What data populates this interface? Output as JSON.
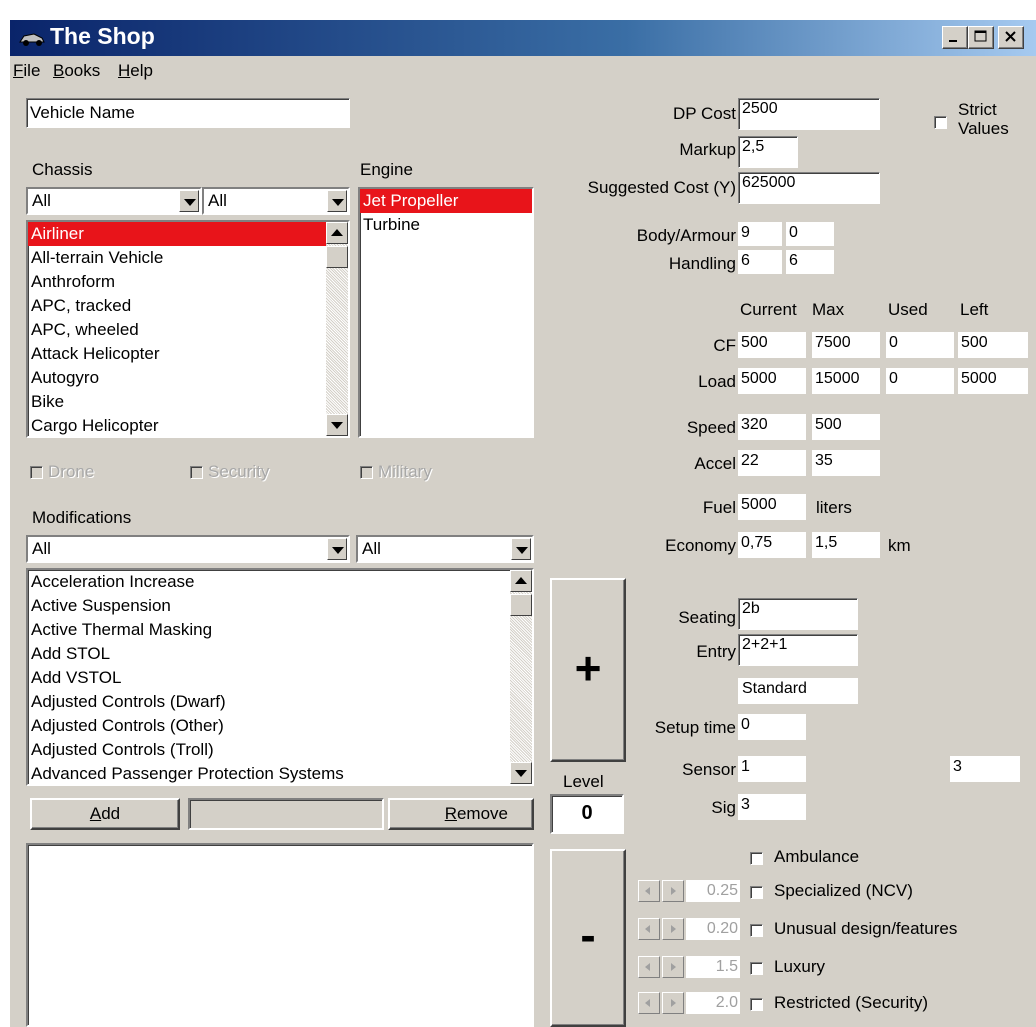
{
  "window": {
    "title": "The Shop"
  },
  "menu": [
    {
      "key": "F",
      "rest": "ile"
    },
    {
      "key": "B",
      "rest": "ooks"
    },
    {
      "key": "H",
      "rest": "elp"
    }
  ],
  "vehicle_name": "Vehicle Name",
  "chassis": {
    "label": "Chassis",
    "filter1": "All",
    "filter2": "All",
    "items": [
      "Airliner",
      "All-terrain Vehicle",
      "Anthroform",
      "APC, tracked",
      "APC, wheeled",
      "Attack Helicopter",
      "Autogyro",
      "Bike",
      "Cargo Helicopter"
    ],
    "selected_index": 0
  },
  "engine": {
    "label": "Engine",
    "items": [
      "Jet Propeller",
      "Turbine"
    ],
    "selected_index": 0
  },
  "flags": {
    "drone": "Drone",
    "security": "Security",
    "military": "Military"
  },
  "modifications": {
    "label": "Modifications",
    "filter1": "All",
    "filter2": "All",
    "items": [
      "Acceleration Increase",
      "Active Suspension",
      "Active Thermal Masking",
      "Add STOL",
      "Add VSTOL",
      "Adjusted Controls (Dwarf)",
      "Adjusted Controls (Other)",
      "Adjusted Controls (Troll)",
      "Advanced Passenger Protection Systems"
    ],
    "add_key": "A",
    "add_rest": "dd",
    "remove_key": "R",
    "remove_rest": "emove"
  },
  "level": {
    "plus": "+",
    "label": "Level",
    "value": "0",
    "minus": "-"
  },
  "stats": {
    "dp_cost_label": "DP Cost",
    "dp_cost": "2500",
    "strict_values": "Strict Values",
    "markup_label": "Markup",
    "markup": "2,5",
    "suggested_label": "Suggested Cost (Y)",
    "suggested": "625000",
    "body_armour_label": "Body/Armour",
    "body": "9",
    "armour": "0",
    "handling_label": "Handling",
    "handling1": "6",
    "handling2": "6",
    "col_current": "Current",
    "col_max": "Max",
    "col_used": "Used",
    "col_left": "Left",
    "cf_label": "CF",
    "cf": [
      "500",
      "7500",
      "0",
      "500"
    ],
    "load_label": "Load",
    "load": [
      "5000",
      "15000",
      "0",
      "5000"
    ],
    "speed_label": "Speed",
    "speed": [
      "320",
      "500"
    ],
    "accel_label": "Accel",
    "accel": [
      "22",
      "35"
    ],
    "fuel_label": "Fuel",
    "fuel": "5000",
    "fuel_unit": "liters",
    "economy_label": "Economy",
    "economy": [
      "0,75",
      "1,5"
    ],
    "economy_unit": "km",
    "seating_label": "Seating",
    "seating": "2b",
    "entry_label": "Entry",
    "entry": "2+2+1",
    "entry_type": "Standard",
    "setup_label": "Setup time",
    "setup": "0",
    "sensor_label": "Sensor",
    "sensor": "1",
    "sensor2": "3",
    "sig_label": "Sig",
    "sig": "3"
  },
  "options": [
    {
      "label": "Ambulance"
    },
    {
      "value": "0.25",
      "label": "Specialized (NCV)"
    },
    {
      "value": "0.20",
      "label": "Unusual design/features"
    },
    {
      "value": "1.5",
      "label": "Luxury"
    },
    {
      "value": "2.0",
      "label": "Restricted (Security)"
    }
  ]
}
